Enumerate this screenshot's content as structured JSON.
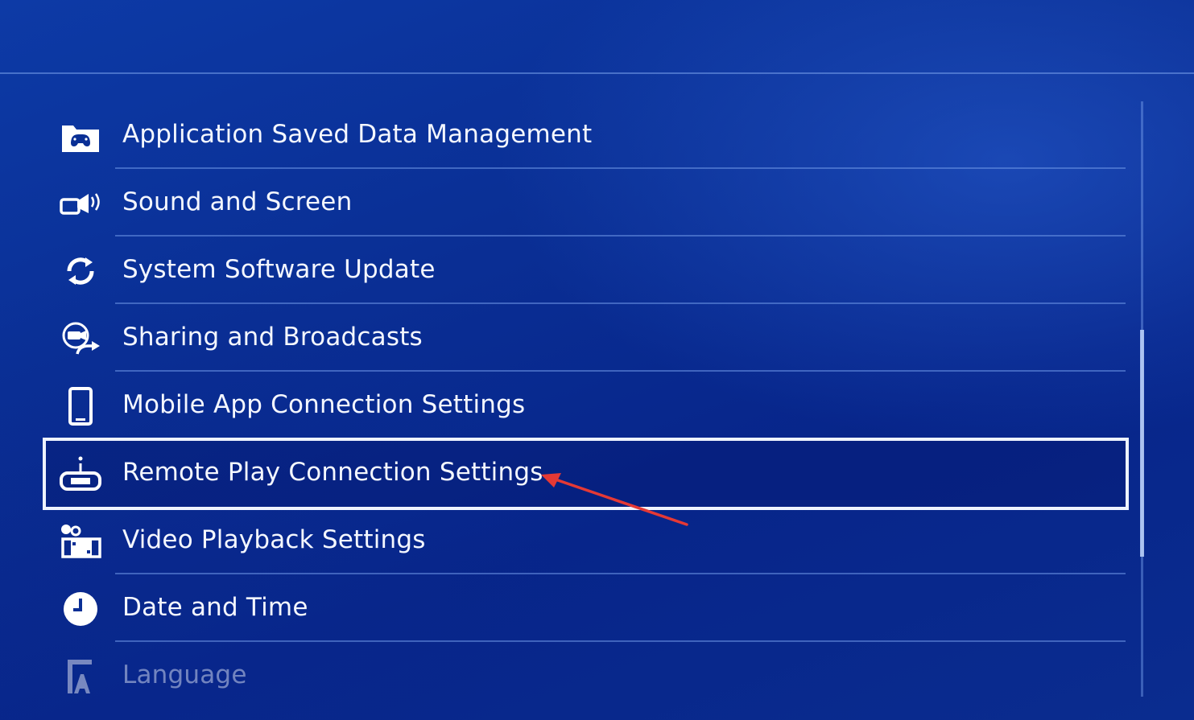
{
  "menu": {
    "items": [
      {
        "label": "Application Saved Data Management",
        "icon": "saved-data-icon"
      },
      {
        "label": "Sound and Screen",
        "icon": "sound-screen-icon"
      },
      {
        "label": "System Software Update",
        "icon": "update-icon"
      },
      {
        "label": "Sharing and Broadcasts",
        "icon": "sharing-icon"
      },
      {
        "label": "Mobile App Connection Settings",
        "icon": "mobile-phone-icon"
      },
      {
        "label": "Remote Play Connection Settings",
        "icon": "remote-play-icon",
        "selected": true
      },
      {
        "label": "Video Playback Settings",
        "icon": "video-playback-icon"
      },
      {
        "label": "Date and Time",
        "icon": "clock-icon"
      },
      {
        "label": "Language",
        "icon": "language-icon"
      }
    ],
    "selected_index": 5
  },
  "scrollbar": {
    "position_fraction": 0.62,
    "visible_fraction": 0.38
  },
  "annotation": {
    "type": "arrow",
    "color": "#e53935",
    "points_to": "Remote Play Connection Settings"
  },
  "colors": {
    "background": "#0a2f95",
    "selection_border": "#eef3ff",
    "text": "#f4f7ff"
  }
}
